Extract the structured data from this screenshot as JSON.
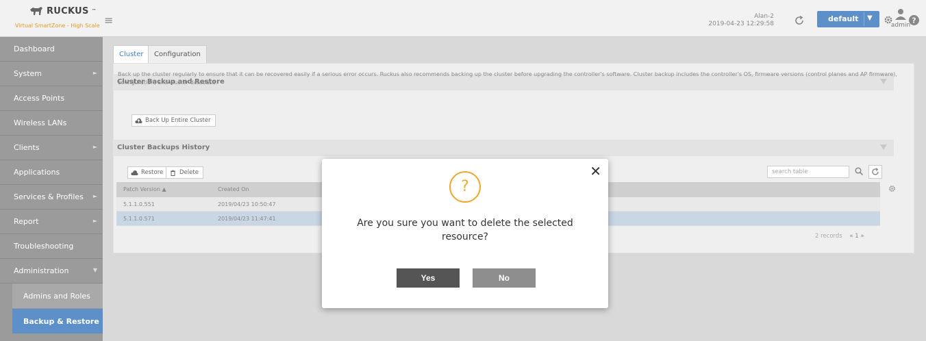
{
  "header": {
    "brand": "RUCKUS",
    "tagline": "Virtual SmartZone - High Scale",
    "system_name": "Alan-2",
    "system_time": "2019-04-23  12:29:58",
    "domain": "default",
    "user": "admin"
  },
  "sidebar": {
    "items": [
      {
        "label": "Dashboard",
        "arrow": ""
      },
      {
        "label": "System",
        "arrow": "►"
      },
      {
        "label": "Access Points",
        "arrow": ""
      },
      {
        "label": "Wireless LANs",
        "arrow": ""
      },
      {
        "label": "Clients",
        "arrow": "►"
      },
      {
        "label": "Applications",
        "arrow": ""
      },
      {
        "label": "Services & Profiles",
        "arrow": "►"
      },
      {
        "label": "Report",
        "arrow": "►"
      },
      {
        "label": "Troubleshooting",
        "arrow": ""
      },
      {
        "label": "Administration",
        "arrow": "▼"
      }
    ],
    "sub_items": [
      {
        "label": "Admins and Roles"
      },
      {
        "label": "Backup & Restore"
      }
    ]
  },
  "tabs": [
    {
      "label": "Cluster"
    },
    {
      "label": "Configuration"
    }
  ],
  "backup_section": {
    "title": "Cluster Backup and Restore",
    "description": "Back up the cluster regularly to ensure that it can be recovered easily if a serious error occurs. Ruckus also recommends backing up the cluster before upgrading the controller's software. Cluster backup includes the controller's OS, firmware versions (control planes and AP firmware), configuration, and cluster database.",
    "backup_button": "Back Up Entire Cluster"
  },
  "history_section": {
    "title": "Cluster Backups History",
    "restore_button": "Restore",
    "delete_button": "Delete",
    "search_placeholder": "search table",
    "columns": [
      "Patch Version ▲",
      "Created On"
    ],
    "rows": [
      {
        "patch": "5.1.1.0.551",
        "created": "2019/04/23 10:50:47"
      },
      {
        "patch": "5.1.1.0.571",
        "created": "2019/04/23 11:47:41"
      }
    ],
    "records": "2 records",
    "page": "«  1  »"
  },
  "dialog": {
    "icon": "?",
    "message": "Are you sure you want to delete the selected resource?",
    "yes": "Yes",
    "no": "No",
    "close": "✕"
  },
  "colors": {
    "accent": "#5d8fc8",
    "sidebar": "#9b9b9b",
    "warning": "#f0a830"
  }
}
